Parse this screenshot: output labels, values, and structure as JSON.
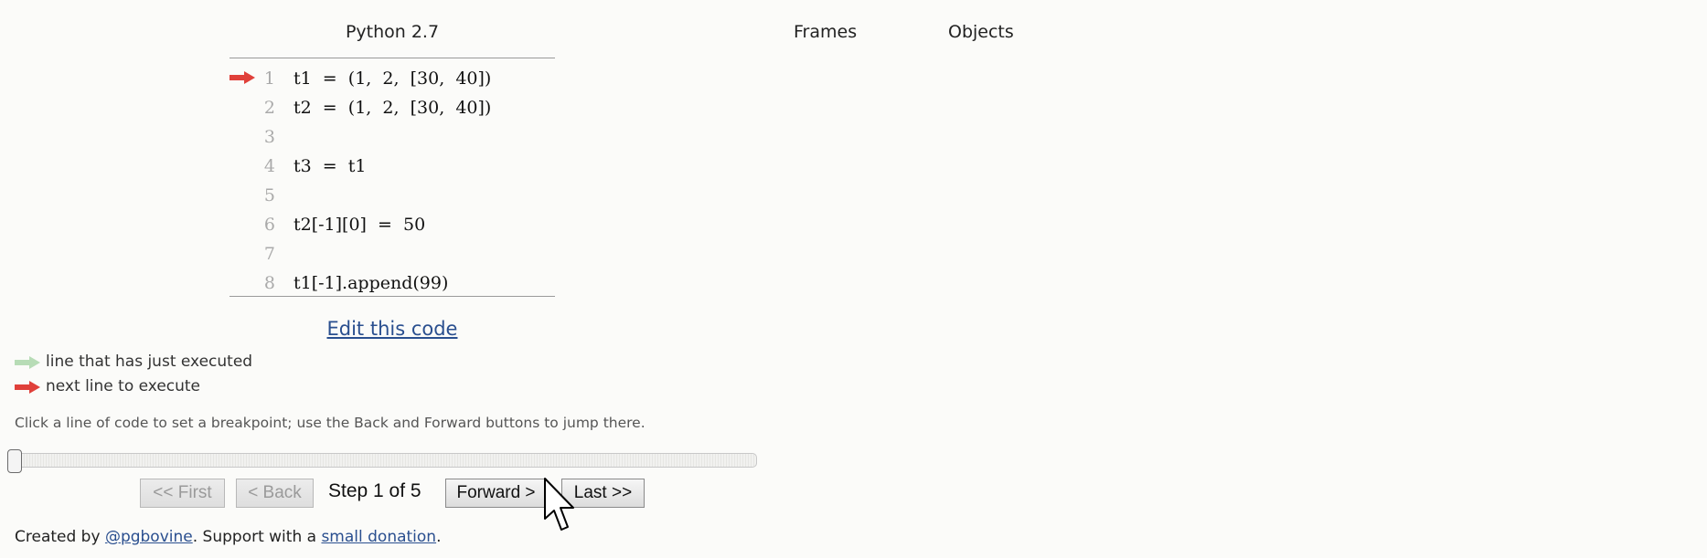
{
  "app": {
    "language": "Python 2.7",
    "frames_label": "Frames",
    "objects_label": "Objects"
  },
  "code": {
    "current_line": 1,
    "lines": [
      {
        "no": "1",
        "text": "t1  =  (1,  2,  [30,  40])"
      },
      {
        "no": "2",
        "text": "t2  =  (1,  2,  [30,  40])"
      },
      {
        "no": "3",
        "text": ""
      },
      {
        "no": "4",
        "text": "t3  =  t1"
      },
      {
        "no": "5",
        "text": ""
      },
      {
        "no": "6",
        "text": "t2[-1][0]  =  50"
      },
      {
        "no": "7",
        "text": ""
      },
      {
        "no": "8",
        "text": "t1[-1].append(99)"
      }
    ]
  },
  "edit_link": "Edit this code",
  "legend": {
    "executed": "line that has just executed",
    "next": "next line to execute",
    "executed_color": "#b7dcb6",
    "next_color": "#e0403a"
  },
  "hint": "Click a line of code to set a breakpoint; use the Back and Forward buttons to jump there.",
  "slider": {
    "position": 0
  },
  "nav": {
    "first": "<< First",
    "back": "< Back",
    "step": "Step 1 of 5",
    "forward": "Forward >",
    "last": "Last >>"
  },
  "footer": {
    "created_by": "Created by ",
    "author": "@pgbovine",
    "support": ". Support with a ",
    "donation": "small donation",
    "end": "."
  },
  "icons": {
    "cursor": "mouse-pointer-icon",
    "arrow": "right-arrow-icon"
  }
}
